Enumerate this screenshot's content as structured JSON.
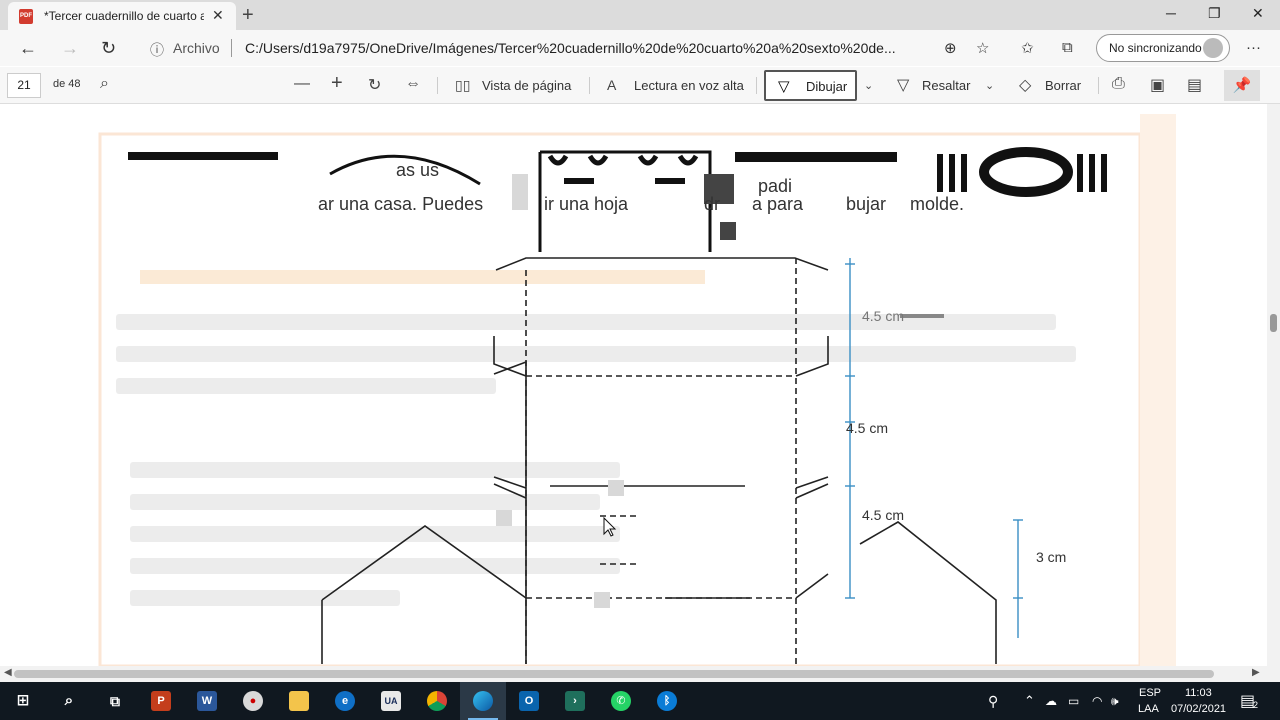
{
  "browser": {
    "tab": {
      "title": "*Tercer cuadernillo de cuarto a sexto",
      "pdf_badge": "PDF",
      "close": "✕"
    },
    "new_tab": "+",
    "window": {
      "minimize": "─",
      "maximize": "❐",
      "close": "✕"
    },
    "nav": {
      "back": "←",
      "forward": "→",
      "refresh": "↻"
    },
    "address": {
      "info_icon": "ⓘ",
      "scheme_label": "Archivo",
      "url": "C:/Users/d19a7975/OneDrive/Imágenes/Tercer%20cuadernillo%20de%20cuarto%20a%20sexto%20de..."
    },
    "profile": {
      "label": "No sincronizando"
    },
    "menu": "···"
  },
  "pdf_toolbar": {
    "page_current": "21",
    "page_total": "de 48",
    "zoom_out": "—",
    "zoom_in": "+",
    "page_view_label": "Vista de página",
    "read_aloud_label": "Lectura en voz alta",
    "draw_label": "Dibujar",
    "highlight_label": "Resaltar",
    "erase_label": "Borrar"
  },
  "document": {
    "line1_fragment": "as us",
    "line1_right": "padi",
    "line2": [
      "ar una casa. Puedes",
      "ir una hoja",
      "dr",
      "a para",
      "bujar",
      "molde."
    ],
    "measurements": [
      "4.5 cm",
      "4.5 cm",
      "4.5 cm",
      "3 cm"
    ]
  },
  "taskbar": {
    "apps": [
      "start",
      "search",
      "task-view",
      "powerpoint",
      "word",
      "paint",
      "explorer",
      "edge-legacy",
      "unam",
      "chrome",
      "edge",
      "outlook",
      "terminal",
      "whatsapp",
      "bluetooth"
    ],
    "language": "ESP",
    "layout": "LAA",
    "time": "11:03",
    "date": "07/02/2021",
    "notifications": "2"
  }
}
